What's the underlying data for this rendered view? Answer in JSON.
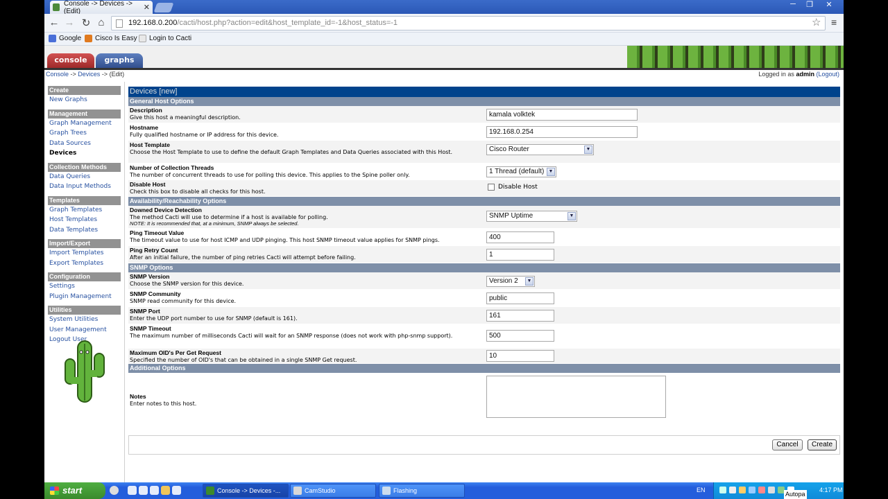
{
  "browser": {
    "tab_title": "Console -> Devices -> (Edit)",
    "url_host": "192.168.0.200",
    "url_path": "/cacti/host.php?action=edit&host_template_id=-1&host_status=-1",
    "bookmarks": [
      {
        "label": "Google",
        "color": "#4a6fd8"
      },
      {
        "label": "Cisco Is Easy",
        "color": "#e07a1f"
      },
      {
        "label": "Login to Cacti",
        "color": "#e8e8e8"
      }
    ]
  },
  "cacti": {
    "tabs": {
      "console": "console",
      "graphs": "graphs"
    },
    "breadcrumb": {
      "console": "Console",
      "sep1": " -> ",
      "devices": "Devices",
      "sep2": " -> ",
      "edit": "(Edit)"
    },
    "logged_in": {
      "prefix": "Logged in as ",
      "user": "admin",
      "logout": "(Logout)"
    },
    "sidebar": [
      {
        "type": "header",
        "label": "Create"
      },
      {
        "type": "item",
        "label": "New Graphs"
      },
      {
        "type": "header",
        "label": "Management"
      },
      {
        "type": "item",
        "label": "Graph Management"
      },
      {
        "type": "item",
        "label": "Graph Trees"
      },
      {
        "type": "item",
        "label": "Data Sources"
      },
      {
        "type": "item",
        "label": "Devices",
        "current": true
      },
      {
        "type": "header",
        "label": "Collection Methods"
      },
      {
        "type": "item",
        "label": "Data Queries"
      },
      {
        "type": "item",
        "label": "Data Input Methods"
      },
      {
        "type": "header",
        "label": "Templates"
      },
      {
        "type": "item",
        "label": "Graph Templates"
      },
      {
        "type": "item",
        "label": "Host Templates"
      },
      {
        "type": "item",
        "label": "Data Templates"
      },
      {
        "type": "header",
        "label": "Import/Export"
      },
      {
        "type": "item",
        "label": "Import Templates"
      },
      {
        "type": "item",
        "label": "Export Templates"
      },
      {
        "type": "header",
        "label": "Configuration"
      },
      {
        "type": "item",
        "label": "Settings"
      },
      {
        "type": "item",
        "label": "Plugin Management"
      },
      {
        "type": "header",
        "label": "Utilities"
      },
      {
        "type": "item",
        "label": "System Utilities"
      },
      {
        "type": "item",
        "label": "User Management"
      },
      {
        "type": "item",
        "label": "Logout User"
      }
    ],
    "form": {
      "title": "Devices",
      "title_suffix": "[new]",
      "sections": {
        "general": "General Host Options",
        "availability": "Availability/Reachability Options",
        "snmp": "SNMP Options",
        "additional": "Additional Options"
      },
      "description": {
        "label": "Description",
        "help": "Give this host a meaningful description.",
        "value": "kamala  volktek"
      },
      "hostname": {
        "label": "Hostname",
        "help": "Fully qualified hostname or IP address for this device.",
        "value": "192.168.0.254"
      },
      "host_template": {
        "label": "Host Template",
        "help": "Choose the Host Template to use to define the default Graph Templates and Data Queries associated with this Host.",
        "value": "Cisco Router"
      },
      "threads": {
        "label": "Number of Collection Threads",
        "help": "The number of concurrent threads to use for polling this device. This applies to the Spine poller only.",
        "value": "1 Thread (default)"
      },
      "disable_host": {
        "label": "Disable Host",
        "help": "Check this box to disable all checks for this host.",
        "checkbox_label": "Disable Host"
      },
      "downed": {
        "label": "Downed Device Detection",
        "help": "The method Cacti will use to determine if a host is available for polling.",
        "note": "NOTE: It is recommended that, at a minimum, SNMP always be selected.",
        "value": "SNMP Uptime"
      },
      "ping_timeout": {
        "label": "Ping Timeout Value",
        "help": "The timeout value to use for host ICMP and UDP pinging. This host SNMP timeout value applies for SNMP pings.",
        "value": "400"
      },
      "ping_retry": {
        "label": "Ping Retry Count",
        "help": "After an initial failure, the number of ping retries Cacti will attempt before failing.",
        "value": "1"
      },
      "snmp_version": {
        "label": "SNMP Version",
        "help": "Choose the SNMP version for this device.",
        "value": "Version 2"
      },
      "snmp_community": {
        "label": "SNMP Community",
        "help": "SNMP read community for this device.",
        "value": "public"
      },
      "snmp_port": {
        "label": "SNMP Port",
        "help": "Enter the UDP port number to use for SNMP (default is 161).",
        "value": "161"
      },
      "snmp_timeout": {
        "label": "SNMP Timeout",
        "help": "The maximum number of milliseconds Cacti will wait for an SNMP response (does not work with php-snmp support).",
        "value": "500"
      },
      "max_oids": {
        "label": "Maximum OID's Per Get Request",
        "help": "Specified the number of OID's that can be obtained in a single SNMP Get request.",
        "value": "10"
      },
      "notes": {
        "label": "Notes",
        "help": "Enter notes to this host.",
        "value": ""
      },
      "buttons": {
        "cancel": "Cancel",
        "create": "Create"
      }
    }
  },
  "taskbar": {
    "start": "start",
    "tasks": [
      {
        "label": "Console -> Devices -...",
        "color": "#3c8a2c"
      },
      {
        "label": "CamStudio",
        "color": "#d8d8d8"
      },
      {
        "label": "Flashing",
        "color": "#cde"
      }
    ],
    "lang": "EN",
    "clock": "4:17 PM",
    "overlay": "Autopa"
  }
}
